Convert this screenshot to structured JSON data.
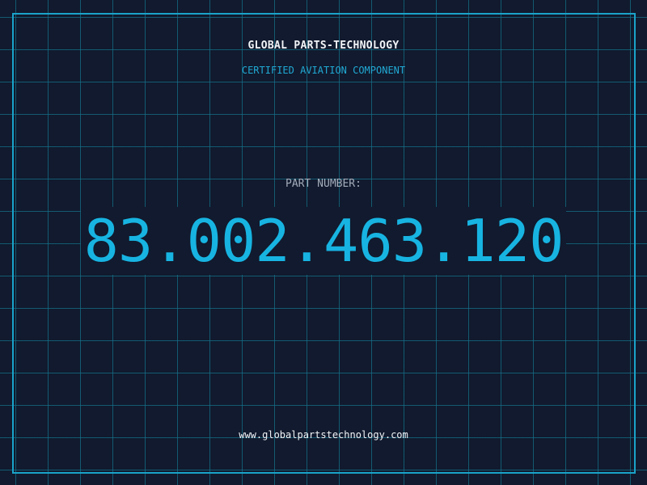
{
  "header": {
    "company": "GLOBAL PARTS-TECHNOLOGY",
    "subtitle": "CERTIFIED AVIATION COMPONENT"
  },
  "part": {
    "label": "PART NUMBER:",
    "number": "83.002.463.120"
  },
  "footer": {
    "url": "www.globalpartstechnology.com"
  },
  "colors": {
    "background": "#111a2e",
    "grid": "#146e87",
    "accent": "#17b4e2",
    "text": "#f2f5f8"
  }
}
